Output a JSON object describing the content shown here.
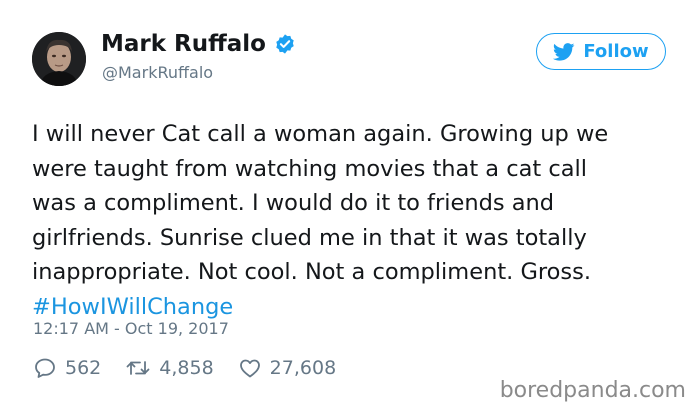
{
  "user": {
    "name": "Mark Ruffalo",
    "handle": "@MarkRuffalo",
    "verified": true
  },
  "follow_button": {
    "label": "Follow",
    "icon": "twitter-bird-icon"
  },
  "tweet": {
    "lines": [
      "I will never Cat call a woman again. Growing up we",
      "were taught from watching movies that a cat call",
      "was a compliment. I would do it to friends and",
      "girlfriends. Sunrise clued me in that it was totally",
      "inappropriate. Not cool. Not a compliment. Gross."
    ],
    "hashtag": "#HowIWillChange",
    "timestamp": "12:17 AM - Oct 19, 2017"
  },
  "stats": {
    "replies": "562",
    "retweets": "4,858",
    "likes": "27,608"
  },
  "watermark": "boredpanda.com",
  "colors": {
    "accent": "#1da1f2",
    "hashtag": "#1b95e0",
    "muted": "#657786",
    "text": "#14171a"
  }
}
